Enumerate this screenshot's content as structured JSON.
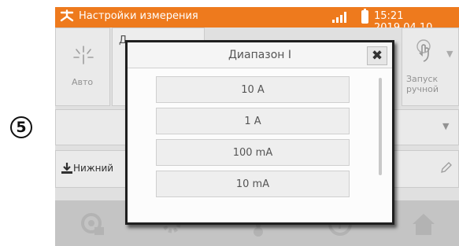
{
  "callout": {
    "number": "5"
  },
  "statusbar": {
    "title": "Настройки измерения",
    "clock": "15:21 2019.04.10",
    "colors": {
      "bar": "#ee7a1d",
      "text": "#ffffff"
    },
    "icons": [
      "settings-fan-icon",
      "signal-icon",
      "battery-icon"
    ]
  },
  "main": {
    "auto_label": "Авто",
    "partial_heading": "Д",
    "start_label": "Запуск\nручной",
    "lower_label": "Нижний",
    "icons": [
      "auto-icon",
      "hand-icon",
      "chevron-down-icon",
      "download-icon",
      "pencil-icon"
    ]
  },
  "modal": {
    "title": "Диапазон I",
    "options": [
      "10 A",
      "1 A",
      "100 mA",
      "10 mA"
    ],
    "close_icon": "close-icon"
  },
  "bottombar": {
    "icons": [
      "measure-icon",
      "gears-icon",
      "thermometer-icon",
      "help-icon",
      "home-icon"
    ]
  }
}
